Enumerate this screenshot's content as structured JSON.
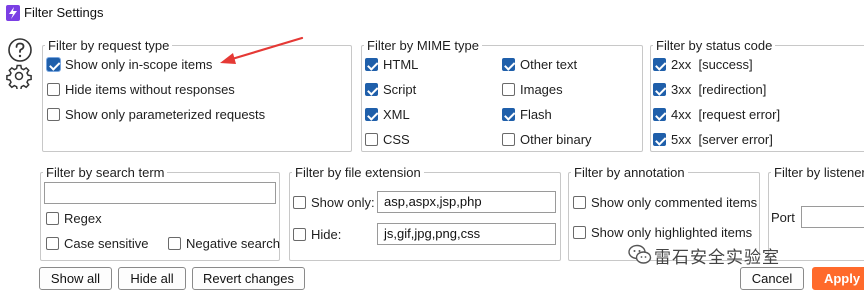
{
  "window": {
    "title": "Filter Settings",
    "colors": {
      "accent": "#1f5faa",
      "primary_button": "#ff6a2b",
      "annotation_arrow": "#e53935"
    },
    "icons": [
      "burp-app-icon",
      "help-icon",
      "gear-icon",
      "wechat-icon",
      "arrow-annotation"
    ]
  },
  "request_type": {
    "legend": "Filter by request type",
    "items": [
      {
        "label": "Show only in-scope items",
        "checked": true
      },
      {
        "label": "Hide items without responses",
        "checked": false
      },
      {
        "label": "Show only parameterized requests",
        "checked": false
      }
    ]
  },
  "mime_type": {
    "legend": "Filter by MIME type",
    "items": [
      {
        "label": "HTML",
        "checked": true
      },
      {
        "label": "Script",
        "checked": true
      },
      {
        "label": "XML",
        "checked": true
      },
      {
        "label": "CSS",
        "checked": false
      },
      {
        "label": "Other text",
        "checked": true
      },
      {
        "label": "Images",
        "checked": false
      },
      {
        "label": "Flash",
        "checked": true
      },
      {
        "label": "Other binary",
        "checked": false
      }
    ]
  },
  "status_code": {
    "legend": "Filter by status code",
    "items": [
      {
        "label": "2xx  [success]",
        "checked": true
      },
      {
        "label": "3xx  [redirection]",
        "checked": true
      },
      {
        "label": "4xx  [request error]",
        "checked": true
      },
      {
        "label": "5xx  [server error]",
        "checked": true
      }
    ]
  },
  "search_term": {
    "legend": "Filter by search term",
    "input_value": "",
    "regex": {
      "label": "Regex",
      "checked": false
    },
    "case_sensitive": {
      "label": "Case sensitive",
      "checked": false
    },
    "negative_search": {
      "label": "Negative search",
      "checked": false
    }
  },
  "file_extension": {
    "legend": "Filter by file extension",
    "show_only": {
      "label": "Show only:",
      "checked": false,
      "value": "asp,aspx,jsp,php"
    },
    "hide": {
      "label": "Hide:",
      "checked": false,
      "value": "js,gif,jpg,png,css"
    }
  },
  "annotation": {
    "legend": "Filter by annotation",
    "items": [
      {
        "label": "Show only commented items",
        "checked": false
      },
      {
        "label": "Show only highlighted items",
        "checked": false
      }
    ]
  },
  "listener": {
    "legend": "Filter by listener",
    "port_label": "Port",
    "port_value": ""
  },
  "buttons": {
    "show_all": "Show all",
    "hide_all": "Hide all",
    "revert": "Revert changes",
    "cancel": "Cancel",
    "apply": "Apply"
  },
  "watermark": {
    "text": "雷石安全实验室"
  }
}
